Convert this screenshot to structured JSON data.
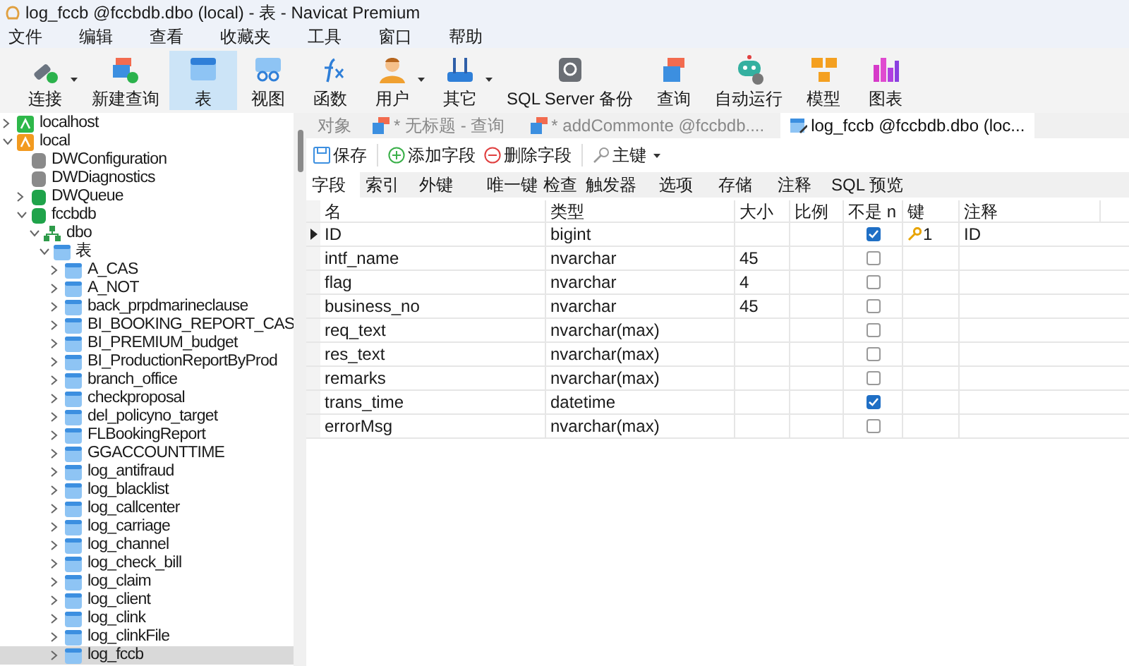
{
  "window": {
    "title": "log_fccb @fccbdb.dbo (local) - 表 - Navicat Premium"
  },
  "menu": [
    "文件",
    "编辑",
    "查看",
    "收藏夹",
    "工具",
    "窗口",
    "帮助"
  ],
  "toolbar": [
    {
      "label": "连接",
      "selected": false,
      "dropdown": true
    },
    {
      "label": "新建查询",
      "selected": false,
      "dropdown": false
    },
    {
      "label": "表",
      "selected": true,
      "dropdown": false
    },
    {
      "label": "视图",
      "selected": false,
      "dropdown": false
    },
    {
      "label": "函数",
      "selected": false,
      "dropdown": false
    },
    {
      "label": "用户",
      "selected": false,
      "dropdown": true
    },
    {
      "label": "其它",
      "selected": false,
      "dropdown": true
    },
    {
      "label": "SQL Server 备份",
      "selected": false,
      "dropdown": false
    },
    {
      "label": "查询",
      "selected": false,
      "dropdown": false
    },
    {
      "label": "自动运行",
      "selected": false,
      "dropdown": false
    },
    {
      "label": "模型",
      "selected": false,
      "dropdown": false
    },
    {
      "label": "图表",
      "selected": false,
      "dropdown": false
    }
  ],
  "tree": [
    {
      "label": "localhost",
      "kind": "connection",
      "color": "#2eb84a",
      "expanded": false,
      "selected": false
    },
    {
      "label": "local",
      "kind": "connection",
      "color": "#f29a1f",
      "expanded": true,
      "selected": false,
      "children": [
        {
          "label": "DWConfiguration",
          "kind": "database",
          "color": "#8a8a8a",
          "selected": false
        },
        {
          "label": "DWDiagnostics",
          "kind": "database",
          "color": "#8a8a8a",
          "selected": false
        },
        {
          "label": "DWQueue",
          "kind": "database",
          "color": "#1fa34a",
          "expanded": false,
          "selected": false
        },
        {
          "label": "fccbdb",
          "kind": "database",
          "color": "#1fa34a",
          "expanded": true,
          "selected": false,
          "children": [
            {
              "label": "dbo",
              "kind": "schema",
              "expanded": true,
              "selected": false,
              "children": [
                {
                  "label": "表",
                  "kind": "folder",
                  "expanded": true,
                  "selected": false,
                  "children": [
                    {
                      "label": "A_CAS",
                      "kind": "table",
                      "expanded": false,
                      "selected": false
                    },
                    {
                      "label": "A_NOT",
                      "kind": "table",
                      "expanded": false,
                      "selected": false
                    },
                    {
                      "label": "back_prpdmarineclause",
                      "kind": "table",
                      "expanded": false,
                      "selected": false
                    },
                    {
                      "label": "BI_BOOKING_REPORT_CAS",
                      "kind": "table",
                      "expanded": false,
                      "selected": false
                    },
                    {
                      "label": "BI_PREMIUM_budget",
                      "kind": "table",
                      "expanded": false,
                      "selected": false
                    },
                    {
                      "label": "BI_ProductionReportByProd",
                      "kind": "table",
                      "expanded": false,
                      "selected": false
                    },
                    {
                      "label": "branch_office",
                      "kind": "table",
                      "expanded": false,
                      "selected": false
                    },
                    {
                      "label": "checkproposal",
                      "kind": "table",
                      "expanded": false,
                      "selected": false
                    },
                    {
                      "label": "del_policyno_target",
                      "kind": "table",
                      "expanded": false,
                      "selected": false
                    },
                    {
                      "label": "FLBookingReport",
                      "kind": "table",
                      "expanded": false,
                      "selected": false
                    },
                    {
                      "label": "GGACCOUNTTIME",
                      "kind": "table",
                      "expanded": false,
                      "selected": false
                    },
                    {
                      "label": "log_antifraud",
                      "kind": "table",
                      "expanded": false,
                      "selected": false
                    },
                    {
                      "label": "log_blacklist",
                      "kind": "table",
                      "expanded": false,
                      "selected": false
                    },
                    {
                      "label": "log_callcenter",
                      "kind": "table",
                      "expanded": false,
                      "selected": false
                    },
                    {
                      "label": "log_carriage",
                      "kind": "table",
                      "expanded": false,
                      "selected": false
                    },
                    {
                      "label": "log_channel",
                      "kind": "table",
                      "expanded": false,
                      "selected": false
                    },
                    {
                      "label": "log_check_bill",
                      "kind": "table",
                      "expanded": false,
                      "selected": false
                    },
                    {
                      "label": "log_claim",
                      "kind": "table",
                      "expanded": false,
                      "selected": false
                    },
                    {
                      "label": "log_client",
                      "kind": "table",
                      "expanded": false,
                      "selected": false
                    },
                    {
                      "label": "log_clink",
                      "kind": "table",
                      "expanded": false,
                      "selected": false
                    },
                    {
                      "label": "log_clinkFile",
                      "kind": "table",
                      "expanded": false,
                      "selected": false
                    },
                    {
                      "label": "log_fccb",
                      "kind": "table",
                      "expanded": false,
                      "selected": true
                    }
                  ]
                }
              ]
            }
          ]
        }
      ]
    }
  ],
  "tabs": [
    {
      "label": "对象",
      "kind": "object",
      "selected": false
    },
    {
      "label": "* 无标题 - 查询",
      "kind": "query",
      "selected": false
    },
    {
      "label": "* addCommonte @fccbdb....",
      "kind": "query",
      "selected": false
    },
    {
      "label": "log_fccb @fccbdb.dbo (loc...",
      "kind": "table",
      "selected": true
    }
  ],
  "editor_toolbar": [
    {
      "label": "保存",
      "kind": "save"
    },
    {
      "label": "添加字段",
      "kind": "add"
    },
    {
      "label": "删除字段",
      "kind": "delete"
    },
    {
      "label": "主键",
      "kind": "key",
      "dropdown": true
    }
  ],
  "subtabs": [
    {
      "label": "字段",
      "selected": true
    },
    {
      "label": "索引",
      "selected": false
    },
    {
      "label": "外键",
      "selected": false
    },
    {
      "label": "唯一键",
      "selected": false
    },
    {
      "label": "检查",
      "selected": false
    },
    {
      "label": "触发器",
      "selected": false
    },
    {
      "label": "选项",
      "selected": false
    },
    {
      "label": "存储",
      "selected": false
    },
    {
      "label": "注释",
      "selected": false
    },
    {
      "label": "SQL 预览",
      "selected": false
    }
  ],
  "table": {
    "columns": [
      "名",
      "类型",
      "大小",
      "比例",
      "不是 n",
      "键",
      "注释"
    ],
    "rows": [
      {
        "current": true,
        "name": "ID",
        "type": "bigint",
        "size": "",
        "not_null": true,
        "key": "1",
        "comment": "ID"
      },
      {
        "current": false,
        "name": "intf_name",
        "type": "nvarchar",
        "size": "45",
        "not_null": false
      },
      {
        "current": false,
        "name": "flag",
        "type": "nvarchar",
        "size": "4",
        "not_null": false
      },
      {
        "current": false,
        "name": "business_no",
        "type": "nvarchar",
        "size": "45",
        "not_null": false
      },
      {
        "current": false,
        "name": "req_text",
        "type": "nvarchar(max)",
        "not_null": false
      },
      {
        "current": false,
        "name": "res_text",
        "type": "nvarchar(max)",
        "not_null": false
      },
      {
        "current": false,
        "name": "remarks",
        "type": "nvarchar(max)",
        "not_null": false
      },
      {
        "current": false,
        "name": "trans_time",
        "type": "datetime",
        "not_null": true
      },
      {
        "current": false,
        "name": "errorMsg",
        "type": "nvarchar(max)",
        "not_null": false
      }
    ]
  }
}
